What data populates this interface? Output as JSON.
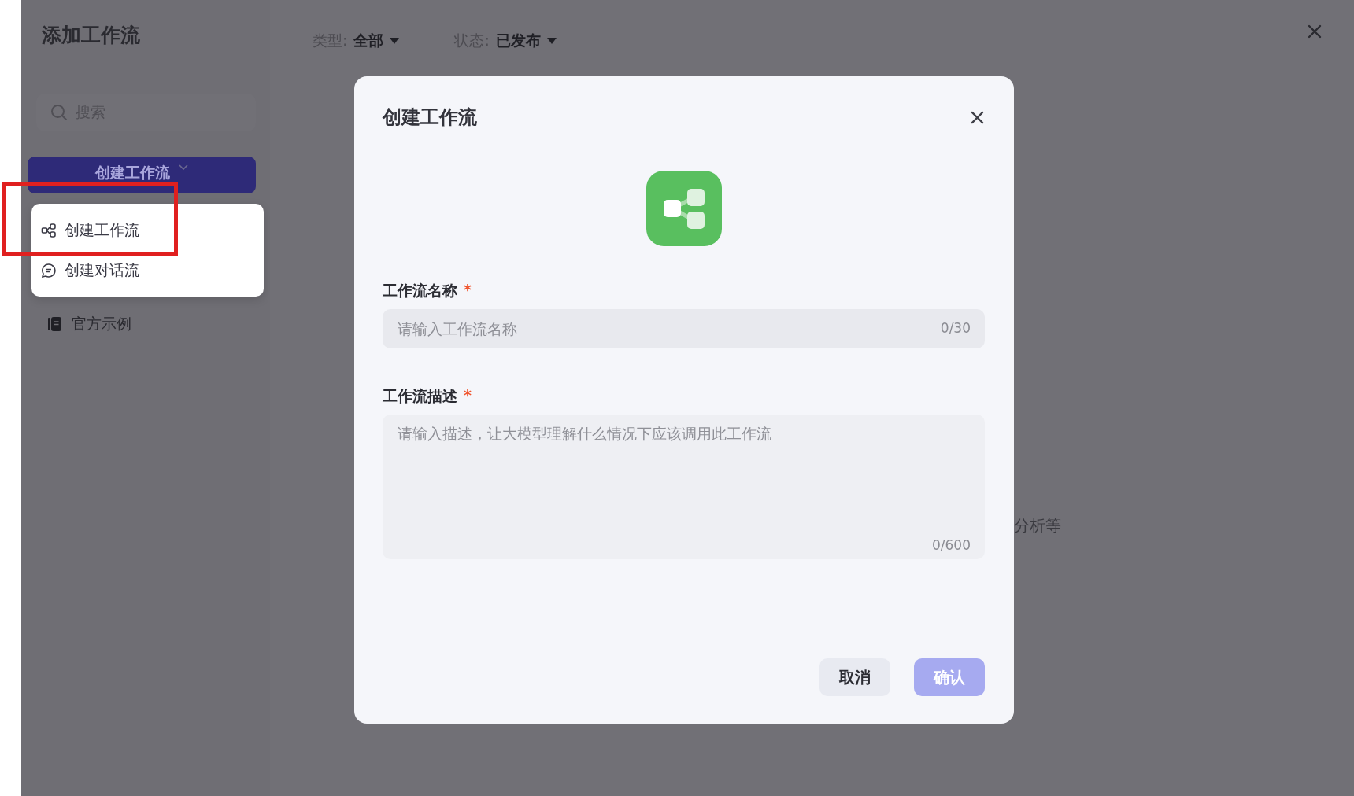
{
  "sidebar": {
    "title": "添加工作流",
    "search": {
      "placeholder": "搜索"
    },
    "create_button": {
      "label": "创建工作流",
      "expanded": true
    },
    "menu": [
      {
        "label": "创建工作流",
        "kind": "workflow"
      },
      {
        "label": "创建对话流",
        "kind": "chat"
      }
    ],
    "items": [
      {
        "label": "官方示例",
        "kind": "book"
      }
    ]
  },
  "filters": [
    {
      "label": "类型:",
      "value": "全部"
    },
    {
      "label": "状态:",
      "value": "已发布"
    }
  ],
  "background_text": "分析等",
  "dialog": {
    "title": "创建工作流",
    "fields": [
      {
        "label": "工作流名称",
        "required_mark": "*",
        "placeholder": "请输入工作流名称",
        "counter": "0/30",
        "kind": "input"
      },
      {
        "label": "工作流描述",
        "required_mark": "*",
        "placeholder": "请输入描述，让大模型理解什么情况下应该调用此工作流",
        "counter": "0/600",
        "kind": "textarea"
      }
    ],
    "buttons": [
      {
        "label": "取消",
        "kind": "secondary",
        "disabled": false
      },
      {
        "label": "确认",
        "kind": "primary",
        "disabled": true
      }
    ]
  }
}
